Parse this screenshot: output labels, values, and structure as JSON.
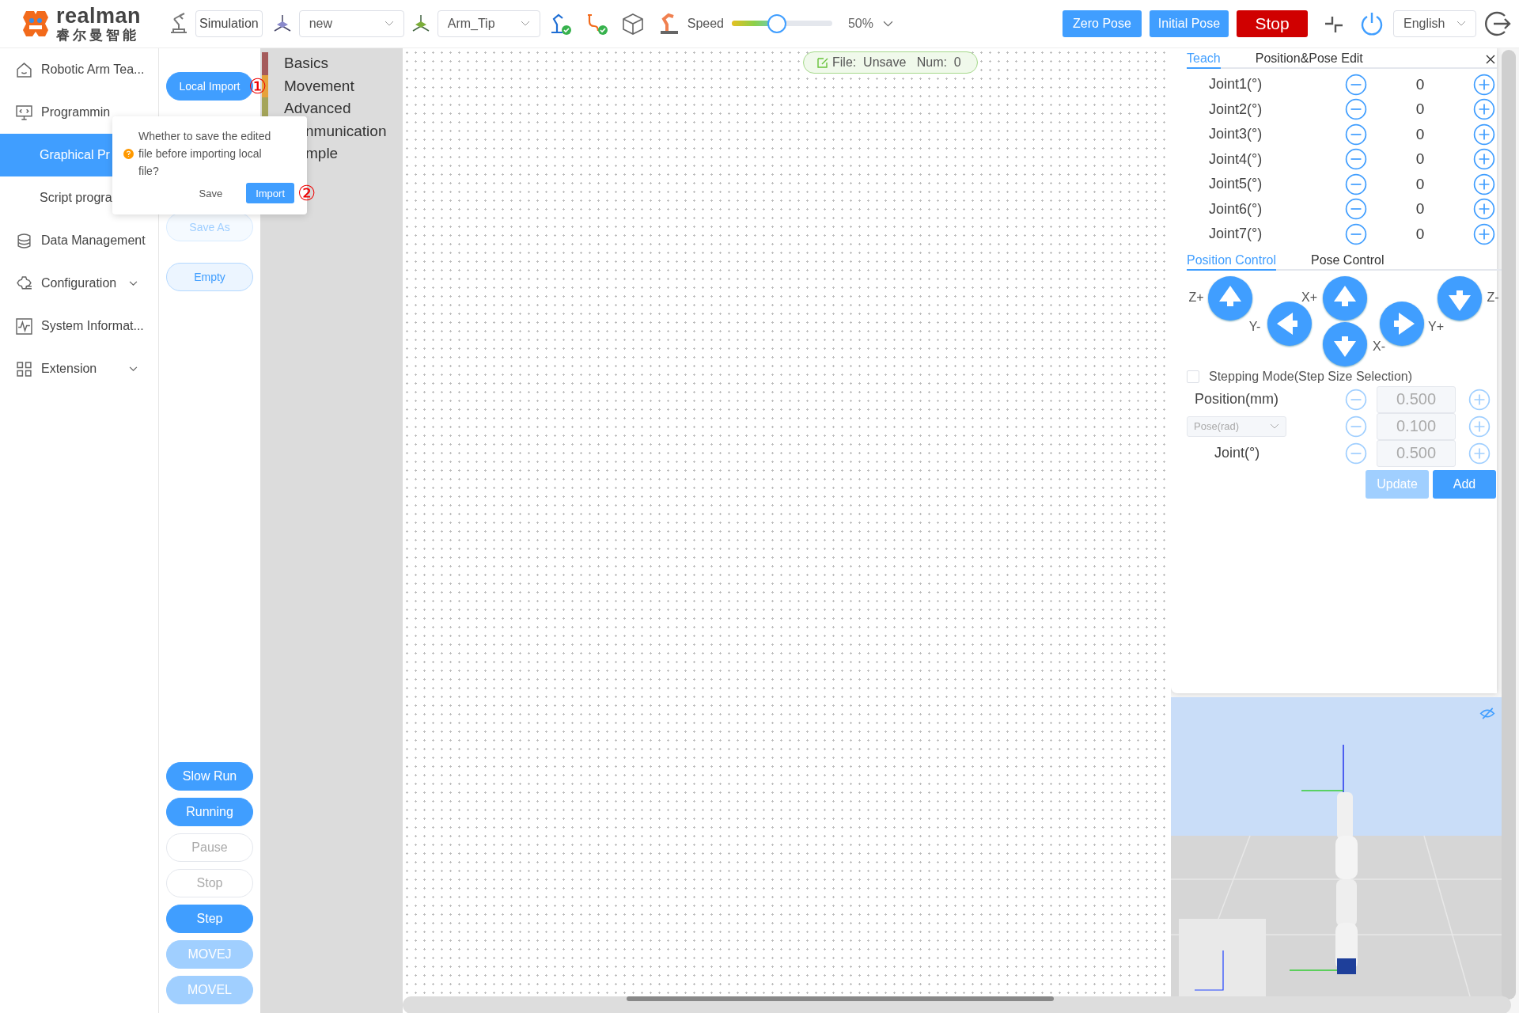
{
  "brand": {
    "name": "realman",
    "subtitle": "睿尔曼智能"
  },
  "toolbar": {
    "mode": "Simulation",
    "work_frame": "new",
    "tool_frame": "Arm_Tip",
    "speed": {
      "label": "Speed",
      "level": 0.45,
      "reading": "50%"
    },
    "buttons": [
      {
        "label": "Zero Pose",
        "kind": "primary"
      },
      {
        "label": "Initial Pose",
        "kind": "primary"
      },
      {
        "label": "Stop",
        "kind": "danger"
      }
    ],
    "language": "English"
  },
  "sidebar": {
    "items": [
      {
        "label": "Robotic Arm Tea...",
        "kind": "link",
        "selected": false
      },
      {
        "label": "Programmin",
        "kind": "link",
        "selected": false
      },
      {
        "label": "Graphical Pr",
        "kind": "sub",
        "selected": true
      },
      {
        "label": "Script progra",
        "kind": "sub",
        "selected": false
      },
      {
        "label": "Data Management",
        "kind": "link",
        "selected": false
      },
      {
        "label": "Configuration",
        "kind": "group",
        "selected": false,
        "expanded": false
      },
      {
        "label": "System Informat...",
        "kind": "link",
        "selected": false
      },
      {
        "label": "Extension",
        "kind": "group",
        "selected": false,
        "expanded": false
      }
    ]
  },
  "file_buttons": [
    {
      "label": "Local Import",
      "kind": "primary",
      "disabled": false,
      "annotation": "①"
    },
    {
      "label": "Save As",
      "kind": "plain",
      "disabled": true
    },
    {
      "label": "Empty",
      "kind": "plain",
      "disabled": false
    }
  ],
  "run_buttons": [
    {
      "label": "Slow Run",
      "kind": "primary",
      "disabled": false
    },
    {
      "label": "Running",
      "kind": "primary",
      "disabled": false
    },
    {
      "label": "Pause",
      "kind": "default",
      "disabled": true
    },
    {
      "label": "Stop",
      "kind": "default",
      "disabled": true
    },
    {
      "label": "Step",
      "kind": "primary",
      "disabled": false
    },
    {
      "label": "MOVEJ",
      "kind": "primary",
      "disabled": true
    },
    {
      "label": "MOVEL",
      "kind": "primary",
      "disabled": true
    }
  ],
  "popconfirm": {
    "message": "Whether to save the edited file before importing local file?",
    "buttons": [
      {
        "label": "Save",
        "kind": "text"
      },
      {
        "label": "Import",
        "kind": "primary",
        "annotation": "②"
      }
    ]
  },
  "categories": [
    {
      "label": "Basics",
      "color": "#a55b5b"
    },
    {
      "label": "Movement",
      "color": "#e6a23c"
    },
    {
      "label": "Advanced",
      "color": "#a5a55a"
    },
    {
      "label": "nmunication"
    },
    {
      "label": "mple"
    }
  ],
  "canvas": {
    "file_status": "File:  Unsave   Num:  0"
  },
  "teach": {
    "tabs": [
      {
        "label": "Teach",
        "selected": true
      },
      {
        "label": "Position&Pose Edit",
        "selected": false
      }
    ],
    "joints": [
      {
        "label": "Joint1(°)",
        "value": "0"
      },
      {
        "label": "Joint2(°)",
        "value": "0"
      },
      {
        "label": "Joint3(°)",
        "value": "0"
      },
      {
        "label": "Joint4(°)",
        "value": "0"
      },
      {
        "label": "Joint5(°)",
        "value": "0"
      },
      {
        "label": "Joint6(°)",
        "value": "0"
      },
      {
        "label": "Joint7(°)",
        "value": "0"
      }
    ],
    "control_tabs": [
      {
        "label": "Position Control",
        "selected": true
      },
      {
        "label": "Pose Control",
        "selected": false
      }
    ],
    "jog": [
      {
        "label": "Z+",
        "kind": "up"
      },
      {
        "label": "Y-",
        "kind": "left"
      },
      {
        "label": "X+",
        "kind": "up"
      },
      {
        "label": "X-",
        "kind": "down"
      },
      {
        "label": "Y+",
        "kind": "right"
      },
      {
        "label": "Z-",
        "kind": "down"
      }
    ],
    "stepping": {
      "label": "Stepping Mode(Step Size Selection)",
      "checked": false
    },
    "steps": [
      {
        "label": "Position(mm)",
        "kind": "label",
        "value": "0.500"
      },
      {
        "label": "Pose(rad)",
        "kind": "select",
        "value": "0.100"
      },
      {
        "label": "Joint(°)",
        "kind": "label",
        "value": "0.500"
      }
    ],
    "actions": [
      {
        "label": "Update",
        "disabled": true
      },
      {
        "label": "Add",
        "disabled": false
      }
    ]
  }
}
